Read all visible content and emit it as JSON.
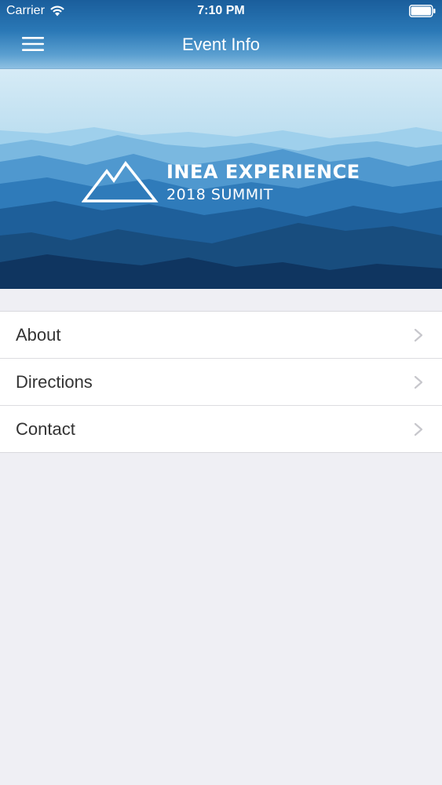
{
  "status_bar": {
    "carrier": "Carrier",
    "time": "7:10 PM"
  },
  "nav": {
    "title": "Event Info",
    "menu_icon": "hamburger-menu-icon"
  },
  "banner": {
    "brand_line1": "INEA EXPERIENCE",
    "brand_line2": "2018 SUMMIT",
    "logo_icon": "mountain-logo-icon"
  },
  "menu": {
    "items": [
      {
        "label": "About"
      },
      {
        "label": "Directions"
      },
      {
        "label": "Contact"
      }
    ]
  },
  "colors": {
    "nav_gradient_top": "#1a5e9c",
    "nav_gradient_bottom": "#8ec0e2",
    "background": "#efeff4",
    "list_text": "#333333",
    "chevron": "#c7c7cc"
  }
}
